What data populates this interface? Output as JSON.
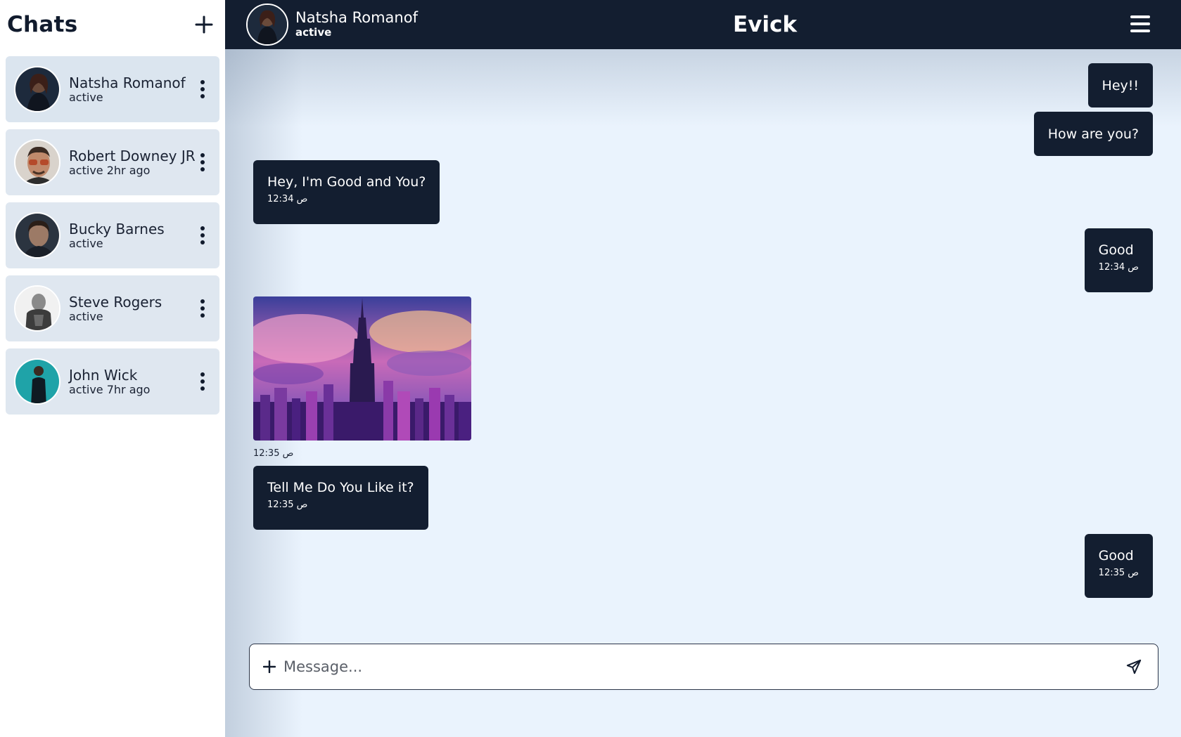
{
  "sidebar": {
    "title": "Chats",
    "add_icon": "plus-icon",
    "items": [
      {
        "name": "Natsha Romanof",
        "status": "active"
      },
      {
        "name": "Robert Downey JR",
        "status": "active 2hr ago"
      },
      {
        "name": "Bucky Barnes",
        "status": "active"
      },
      {
        "name": "Steve Rogers",
        "status": "active"
      },
      {
        "name": "John Wick",
        "status": "active 7hr ago"
      }
    ]
  },
  "header": {
    "contact_name": "Natsha Romanof",
    "contact_status": "active",
    "app_title": "Evick",
    "menu_icon": "hamburger-menu-icon"
  },
  "messages": [
    {
      "side": "sent",
      "text": "Hey!!"
    },
    {
      "side": "sent",
      "text": "How are you?"
    },
    {
      "side": "received",
      "text": "Hey, I'm Good and You?",
      "time": "12:34 ص"
    },
    {
      "side": "sent",
      "text": "Good",
      "time": "12:34 ص"
    },
    {
      "side": "received",
      "type": "image",
      "alt": "city skyline illustration",
      "time": "12:35 ص"
    },
    {
      "side": "received",
      "text": "Tell Me Do You Like it?",
      "time": "12:35 ص"
    },
    {
      "side": "sent",
      "text": "Good",
      "time": "12:35 ص"
    }
  ],
  "composer": {
    "placeholder": "Message...",
    "attach_icon": "plus-icon",
    "send_icon": "send-icon"
  },
  "colors": {
    "dark": "#131e30",
    "chat_bg": "#eaf3fd",
    "list_item_bg": "#dfe7f0"
  }
}
